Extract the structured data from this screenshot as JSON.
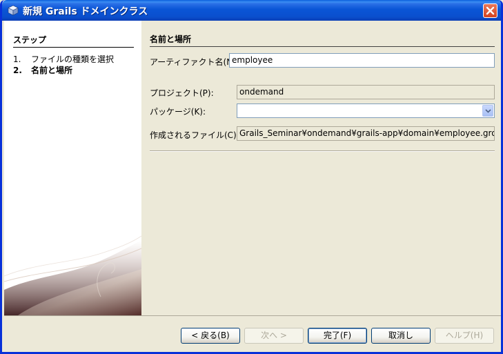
{
  "window": {
    "title": "新規 Grails ドメインクラス"
  },
  "steps": {
    "heading": "ステップ",
    "items": [
      {
        "num": "1.",
        "label": "ファイルの種類を選択"
      },
      {
        "num": "2.",
        "label": "名前と場所"
      }
    ]
  },
  "main": {
    "section_title": "名前と場所",
    "artifact_label": "アーティファクト名(N):",
    "artifact_value": "employee",
    "project_label": "プロジェクト(P):",
    "project_value": "ondemand",
    "package_label": "パッケージ(K):",
    "package_value": "",
    "created_file_label": "作成されるファイル(C):",
    "created_file_value": "Grails_Seminar¥ondemand¥grails-app¥domain¥employee.groovy"
  },
  "buttons": {
    "back": "< 戻る(B)",
    "next": "次へ >",
    "finish": "完了(F)",
    "cancel": "取消し",
    "help": "ヘルプ(H)"
  }
}
